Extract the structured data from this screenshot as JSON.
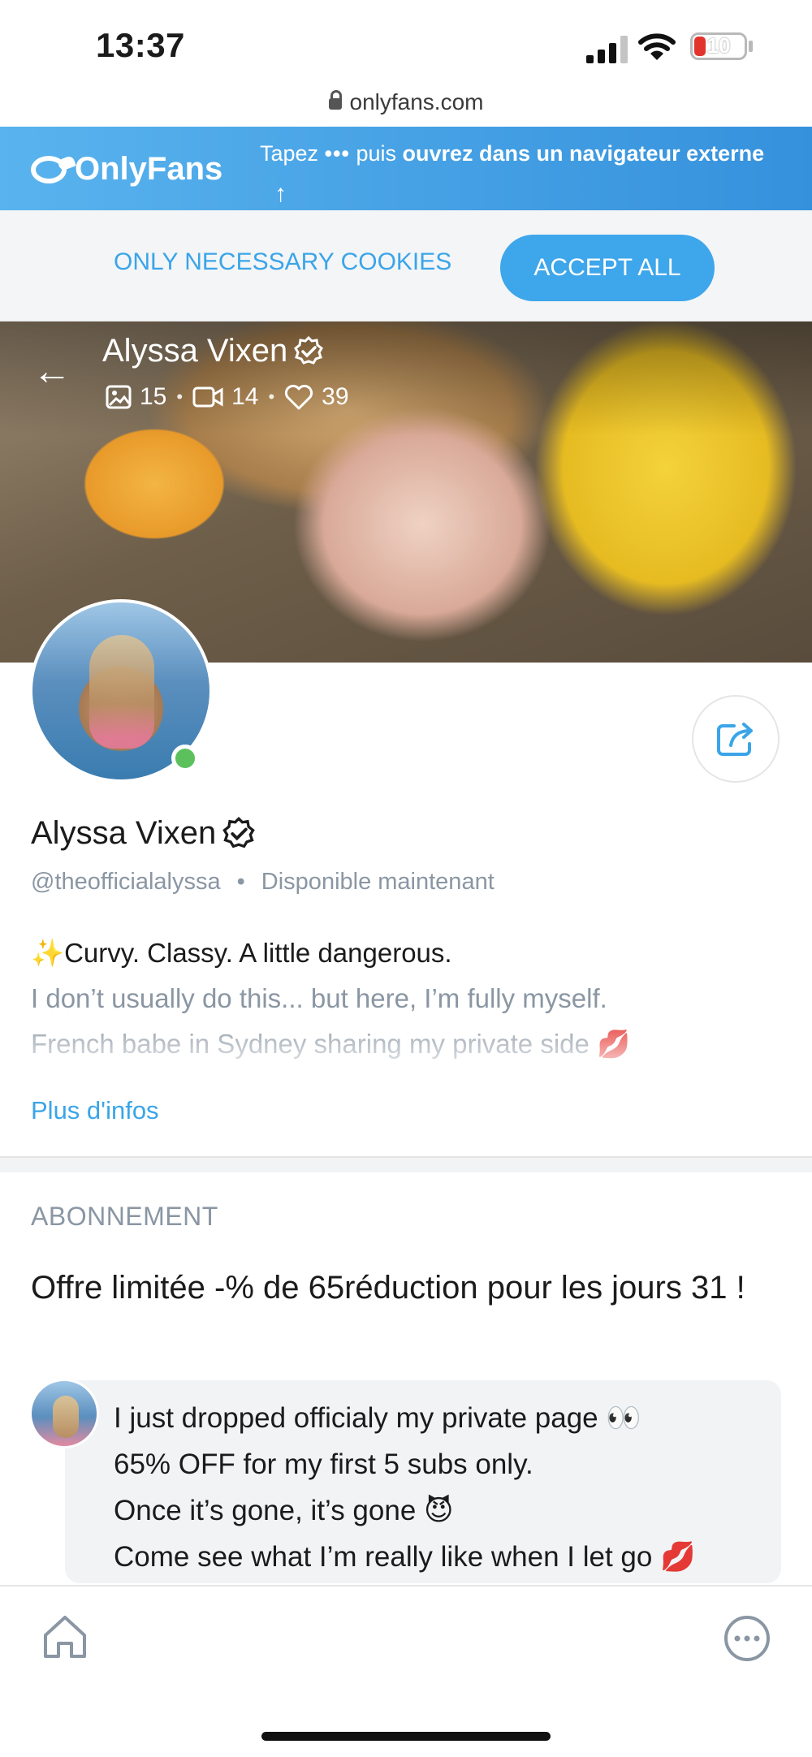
{
  "status_bar": {
    "time": "13:37",
    "battery": "10"
  },
  "browser": {
    "url": "onlyfans.com"
  },
  "header": {
    "logo_text": "OnlyFans",
    "instruction_prefix": "Tapez",
    "instruction_dots": "•••",
    "instruction_mid": "puis",
    "instruction_bold": "ouvrez dans un navigateur externe"
  },
  "cookies": {
    "necessary_label": "ONLY NECESSARY COOKIES",
    "accept_label": "ACCEPT ALL"
  },
  "cover": {
    "name": "Alyssa Vixen",
    "stats": {
      "photos": "15",
      "videos": "14",
      "likes": "39"
    }
  },
  "profile": {
    "name": "Alyssa Vixen",
    "handle": "@theofficialalyssa",
    "separator": "•",
    "availability": "Disponible maintenant",
    "bio_line1": "✨Curvy. Classy. A little dangerous.",
    "bio_line2": "I don’t usually do this... but here, I’m fully myself.",
    "bio_line3": "French babe in Sydney sharing my private side 💋",
    "more_label": "Plus d'infos"
  },
  "subscription": {
    "section_label": "ABONNEMENT",
    "offer_title": "Offre limitée -% de 65réduction pour les jours 31 !",
    "message_lines": [
      "I just dropped officialy my private page 👀",
      "65% OFF for my first 5 subs only.",
      "Once it’s gone, it’s gone 😈",
      "Come see what I’m really like when I let go 💋"
    ]
  },
  "colors": {
    "brand_blue": "#3ea6ea",
    "online_green": "#5cc15c",
    "muted_text": "#8a96a3"
  }
}
